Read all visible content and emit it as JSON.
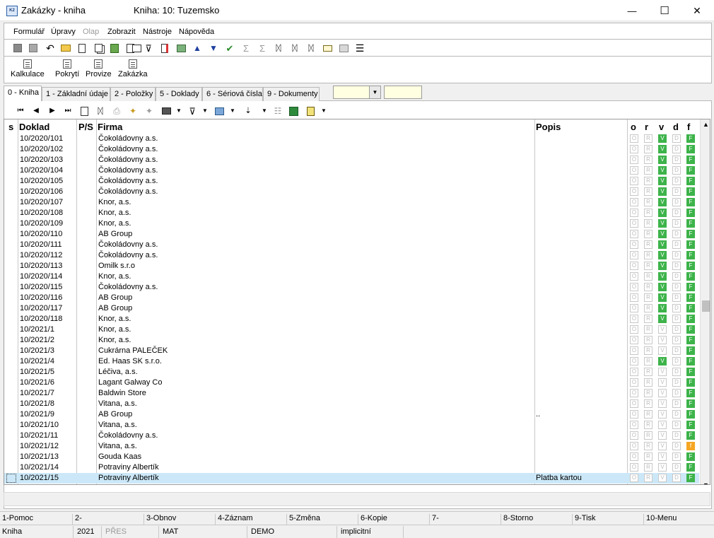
{
  "window": {
    "app_title": "Zakázky - kniha",
    "book_title": "Kniha: 10: Tuzemsko",
    "app_icon_text": "K2",
    "minimize": "—",
    "maximize": "☐",
    "close": "✕"
  },
  "menu": [
    {
      "label": "Formulář",
      "enabled": true
    },
    {
      "label": "Úpravy",
      "enabled": true
    },
    {
      "label": "Olap",
      "enabled": false
    },
    {
      "label": "Zobrazit",
      "enabled": true
    },
    {
      "label": "Nástroje",
      "enabled": true
    },
    {
      "label": "Nápověda",
      "enabled": true
    }
  ],
  "toolbar1_icons": [
    "save-icon",
    "save-all-icon",
    "undo-icon",
    "open-folder-icon",
    "new-document-icon",
    "copy-document-icon",
    "lock-icon",
    "print-preview-icon",
    "book-icon",
    "filter-icon",
    "delete-filter-icon",
    "books-icon",
    "arrow-up-icon",
    "arrow-down-icon",
    "check-icon",
    "sigma-icon",
    "sigma-off-icon",
    "binoculars-icon",
    "binoculars-next-icon",
    "binoculars-prev-icon",
    "mail-icon",
    "edit-icon",
    "menu-icon"
  ],
  "toolbar2": [
    {
      "label": "Kalkulace"
    },
    {
      "label": "Pokrytí"
    },
    {
      "label": "Provize"
    },
    {
      "label": "Zakázka"
    }
  ],
  "tabs": [
    {
      "label": "0 - Kniha",
      "active": true
    },
    {
      "label": "1 - Základní údaje"
    },
    {
      "label": "2 - Položky"
    },
    {
      "label": "5 - Doklady"
    },
    {
      "label": "6 - Sériová čísla"
    },
    {
      "label": "9 - Dokumenty"
    }
  ],
  "combo": {
    "value": "",
    "arrow": "▼"
  },
  "combo2": {
    "value": ""
  },
  "toolbar3_icons": [
    "first-record-icon",
    "prev-record-icon",
    "next-record-icon",
    "last-record-icon",
    "refresh-icon",
    "find-icon",
    "print-icon",
    "add-star-icon",
    "remove-star-icon",
    "camera-icon",
    "filter-icon",
    "export-icon",
    "sort-icon",
    "list-icon",
    "excel-icon",
    "columns-icon"
  ],
  "grid": {
    "columns": {
      "s": "s",
      "doklad": "Doklad",
      "ps": "P/S",
      "firma": "Firma",
      "popis": "Popis",
      "o": "o",
      "r": "r",
      "v": "v",
      "d": "d",
      "f": "f"
    },
    "rows": [
      {
        "doklad": "10/2020/101",
        "firma": "Čokoládovny a.s.",
        "popis": "",
        "o": "O",
        "r": "R",
        "v": "V",
        "d": "D",
        "f": "F",
        "v_on": true,
        "f_state": "on"
      },
      {
        "doklad": "10/2020/102",
        "firma": "Čokoládovny a.s.",
        "popis": "",
        "o": "O",
        "r": "R",
        "v": "V",
        "d": "D",
        "f": "F",
        "v_on": true,
        "f_state": "on"
      },
      {
        "doklad": "10/2020/103",
        "firma": "Čokoládovny a.s.",
        "popis": "",
        "o": "O",
        "r": "R",
        "v": "V",
        "d": "D",
        "f": "F",
        "v_on": true,
        "f_state": "on"
      },
      {
        "doklad": "10/2020/104",
        "firma": "Čokoládovny a.s.",
        "popis": "",
        "o": "O",
        "r": "R",
        "v": "V",
        "d": "D",
        "f": "F",
        "v_on": true,
        "f_state": "on"
      },
      {
        "doklad": "10/2020/105",
        "firma": "Čokoládovny a.s.",
        "popis": "",
        "o": "O",
        "r": "R",
        "v": "V",
        "d": "D",
        "f": "F",
        "v_on": true,
        "f_state": "on"
      },
      {
        "doklad": "10/2020/106",
        "firma": "Čokoládovny a.s.",
        "popis": "",
        "o": "O",
        "r": "R",
        "v": "V",
        "d": "D",
        "f": "F",
        "v_on": true,
        "f_state": "on"
      },
      {
        "doklad": "10/2020/107",
        "firma": "Knor, a.s.",
        "popis": "",
        "o": "O",
        "r": "R",
        "v": "V",
        "d": "D",
        "f": "F",
        "v_on": true,
        "f_state": "on"
      },
      {
        "doklad": "10/2020/108",
        "firma": "Knor, a.s.",
        "popis": "",
        "o": "O",
        "r": "R",
        "v": "V",
        "d": "D",
        "f": "F",
        "v_on": true,
        "f_state": "on"
      },
      {
        "doklad": "10/2020/109",
        "firma": "Knor, a.s.",
        "popis": "",
        "o": "O",
        "r": "R",
        "v": "V",
        "d": "D",
        "f": "F",
        "v_on": true,
        "f_state": "on"
      },
      {
        "doklad": "10/2020/110",
        "firma": "AB Group",
        "popis": "",
        "o": "O",
        "r": "R",
        "v": "V",
        "d": "D",
        "f": "F",
        "v_on": true,
        "f_state": "on"
      },
      {
        "doklad": "10/2020/111",
        "firma": "Čokoládovny a.s.",
        "popis": "",
        "o": "O",
        "r": "R",
        "v": "V",
        "d": "D",
        "f": "F",
        "v_on": true,
        "f_state": "on"
      },
      {
        "doklad": "10/2020/112",
        "firma": "Čokoládovny a.s.",
        "popis": "",
        "o": "O",
        "r": "R",
        "v": "V",
        "d": "D",
        "f": "F",
        "v_on": true,
        "f_state": "on"
      },
      {
        "doklad": "10/2020/113",
        "firma": "Omilk s.r.o",
        "popis": "",
        "o": "O",
        "r": "R",
        "v": "V",
        "d": "D",
        "f": "F",
        "v_on": true,
        "f_state": "on"
      },
      {
        "doklad": "10/2020/114",
        "firma": "Knor, a.s.",
        "popis": "",
        "o": "O",
        "r": "R",
        "v": "V",
        "d": "D",
        "f": "F",
        "v_on": true,
        "f_state": "on"
      },
      {
        "doklad": "10/2020/115",
        "firma": "Čokoládovny a.s.",
        "popis": "",
        "o": "O",
        "r": "R",
        "v": "V",
        "d": "D",
        "f": "F",
        "v_on": true,
        "f_state": "on"
      },
      {
        "doklad": "10/2020/116",
        "firma": "AB Group",
        "popis": "",
        "o": "O",
        "r": "R",
        "v": "V",
        "d": "D",
        "f": "F",
        "v_on": true,
        "f_state": "on"
      },
      {
        "doklad": "10/2020/117",
        "firma": "AB Group",
        "popis": "",
        "o": "O",
        "r": "R",
        "v": "V",
        "d": "D",
        "f": "F",
        "v_on": true,
        "f_state": "on"
      },
      {
        "doklad": "10/2020/118",
        "firma": "Knor, a.s.",
        "popis": "",
        "o": "O",
        "r": "R",
        "v": "V",
        "d": "D",
        "f": "F",
        "v_on": true,
        "f_state": "on"
      },
      {
        "doklad": "10/2021/1",
        "firma": "Knor, a.s.",
        "popis": "",
        "o": "O",
        "r": "R",
        "v": "V",
        "d": "D",
        "f": "F",
        "v_on": false,
        "f_state": "on"
      },
      {
        "doklad": "10/2021/2",
        "firma": "Knor, a.s.",
        "popis": "",
        "o": "O",
        "r": "R",
        "v": "V",
        "d": "D",
        "f": "F",
        "v_on": false,
        "f_state": "on"
      },
      {
        "doklad": "10/2021/3",
        "firma": "Cukrárna PALEČEK",
        "popis": "",
        "o": "O",
        "r": "R",
        "v": "V",
        "d": "D",
        "f": "F",
        "v_on": false,
        "f_state": "on"
      },
      {
        "doklad": "10/2021/4",
        "firma": "Ed. Haas SK s.r.o.",
        "popis": "",
        "o": "O",
        "r": "R",
        "v": "V",
        "d": "D",
        "f": "F",
        "v_on": true,
        "f_state": "on"
      },
      {
        "doklad": "10/2021/5",
        "firma": "Léčiva, a.s.",
        "popis": "",
        "o": "O",
        "r": "R",
        "v": "V",
        "d": "D",
        "f": "F",
        "v_on": false,
        "f_state": "on"
      },
      {
        "doklad": "10/2021/6",
        "firma": "Lagant Galway Co",
        "popis": "",
        "o": "O",
        "r": "R",
        "v": "V",
        "d": "D",
        "f": "F",
        "v_on": false,
        "f_state": "on"
      },
      {
        "doklad": "10/2021/7",
        "firma": "Baldwin Store",
        "popis": "",
        "o": "O",
        "r": "R",
        "v": "V",
        "d": "D",
        "f": "F",
        "v_on": false,
        "f_state": "on"
      },
      {
        "doklad": "10/2021/8",
        "firma": "Vitana, a.s.",
        "popis": "",
        "o": "O",
        "r": "R",
        "v": "V",
        "d": "D",
        "f": "F",
        "v_on": false,
        "f_state": "on"
      },
      {
        "doklad": "10/2021/9",
        "firma": "AB Group",
        "popis": "..",
        "o": "O",
        "r": "R",
        "v": "V",
        "d": "D",
        "f": "F",
        "v_on": false,
        "f_state": "on"
      },
      {
        "doklad": "10/2021/10",
        "firma": "Vitana, a.s.",
        "popis": "",
        "o": "O",
        "r": "R",
        "v": "V",
        "d": "D",
        "f": "F",
        "v_on": false,
        "f_state": "on"
      },
      {
        "doklad": "10/2021/11",
        "firma": "Čokoládovny a.s.",
        "popis": "",
        "o": "O",
        "r": "R",
        "v": "V",
        "d": "D",
        "f": "F",
        "v_on": false,
        "f_state": "on"
      },
      {
        "doklad": "10/2021/12",
        "firma": "Vitana, a.s.",
        "popis": "",
        "o": "O",
        "r": "R",
        "v": "V",
        "d": "D",
        "f": "f",
        "v_on": false,
        "f_state": "warn"
      },
      {
        "doklad": "10/2021/13",
        "firma": "Gouda Kaas",
        "popis": "",
        "o": "O",
        "r": "R",
        "v": "V",
        "d": "D",
        "f": "F",
        "v_on": false,
        "f_state": "on"
      },
      {
        "doklad": "10/2021/14",
        "firma": "Potraviny Albertík",
        "popis": "",
        "o": "O",
        "r": "R",
        "v": "V",
        "d": "D",
        "f": "F",
        "v_on": false,
        "f_state": "on"
      },
      {
        "doklad": "10/2021/15",
        "firma": "Potraviny Albertík",
        "popis": "Platba kartou",
        "o": "O",
        "r": "R",
        "v": "V",
        "d": "D",
        "f": "F",
        "v_on": false,
        "f_state": "on",
        "selected": true
      }
    ]
  },
  "scroll": {
    "up": "▲",
    "down": "▼"
  },
  "function_keys": [
    "1-Pomoc",
    "2-",
    "3-Obnov",
    "4-Záznam",
    "5-Změna",
    "6-Kopie",
    "7-",
    "8-Storno",
    "9-Tisk",
    "10-Menu"
  ],
  "status": [
    {
      "label": "Kniha",
      "enabled": true
    },
    {
      "label": "2021",
      "enabled": true
    },
    {
      "label": "PŘES",
      "enabled": false
    },
    {
      "label": "MAT",
      "enabled": true
    },
    {
      "label": "DEMO",
      "enabled": true
    },
    {
      "label": "implicitní",
      "enabled": true
    }
  ],
  "colors": {
    "accent": "#3db34a",
    "warn": "#f5a623",
    "selected_row": "#cce8f8",
    "combo_bg": "#ffffe1"
  }
}
